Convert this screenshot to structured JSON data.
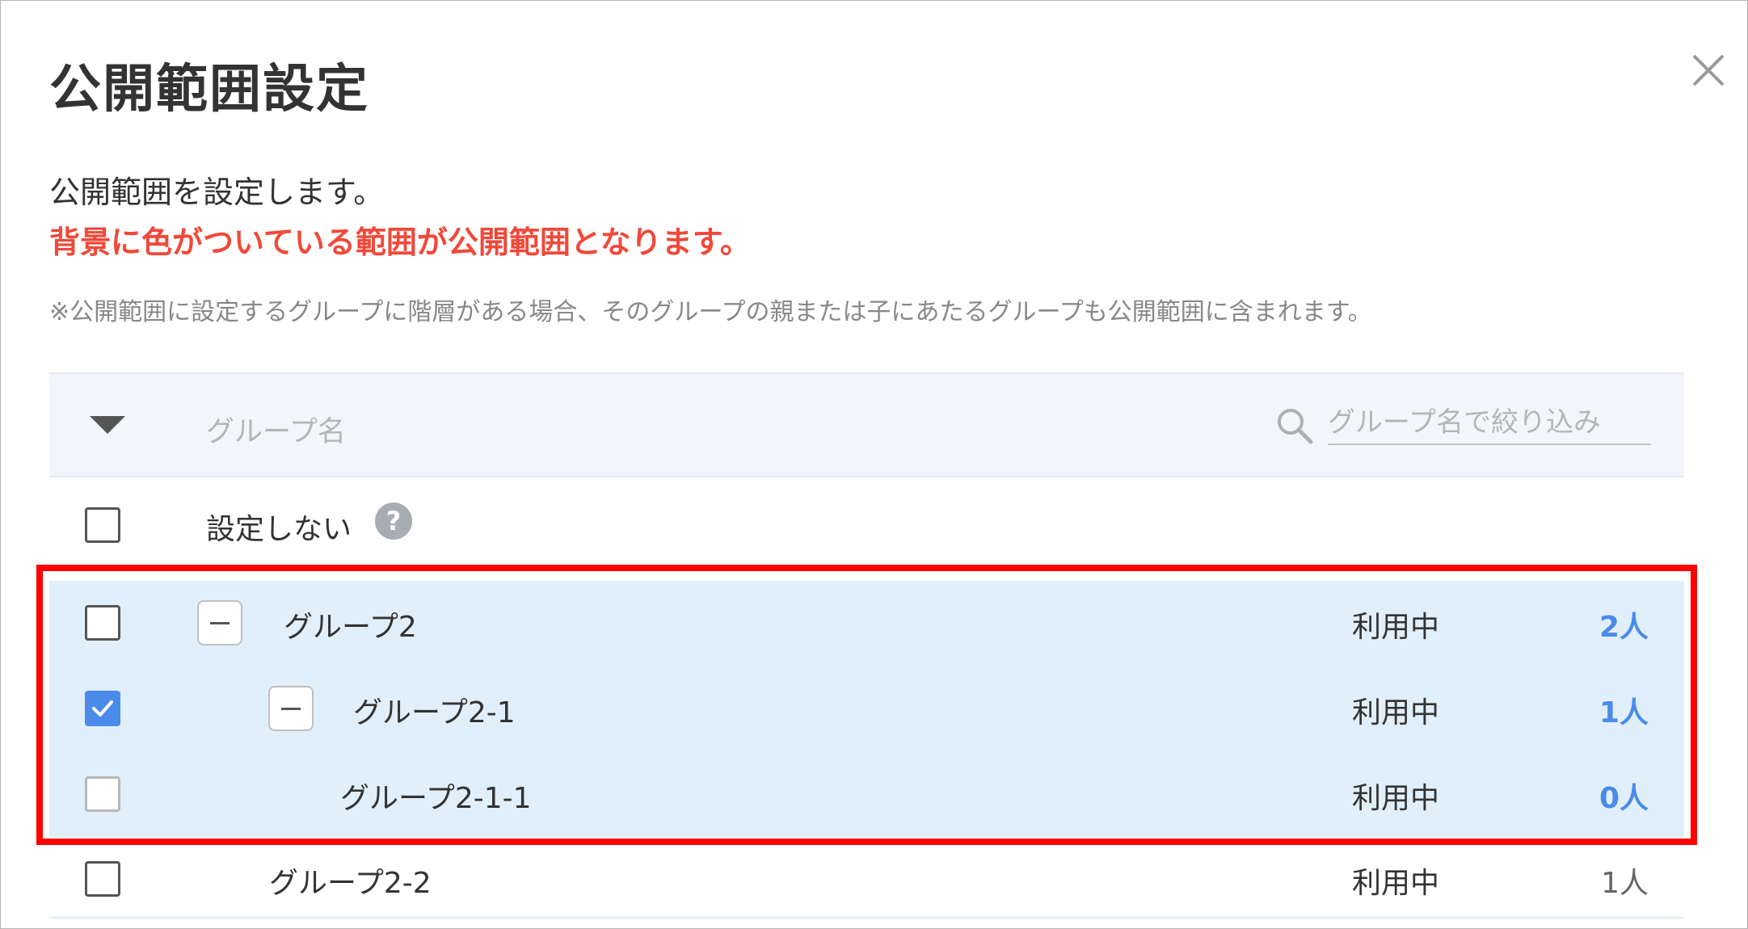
{
  "dialog": {
    "title": "公開範囲設定",
    "description": "公開範囲を設定します。",
    "warning": "背景に色がついている範囲が公開範囲となります。",
    "note": "※公開範囲に設定するグループに階層がある場合、そのグループの親または子にあたるグループも公開範囲に含まれます。"
  },
  "table": {
    "column_name": "グループ名",
    "filter_placeholder": "グループ名で絞り込み",
    "none_option_label": "設定しない",
    "help_glyph": "?",
    "rows": [
      {
        "name": "グループ2",
        "status": "利用中",
        "count": "2人",
        "checked": false,
        "highlighted": true
      },
      {
        "name": "グループ2-1",
        "status": "利用中",
        "count": "1人",
        "checked": true,
        "highlighted": true
      },
      {
        "name": "グループ2-1-1",
        "status": "利用中",
        "count": "0人",
        "checked": false,
        "highlighted": true
      },
      {
        "name": "グループ2-2",
        "status": "利用中",
        "count": "1人",
        "checked": false,
        "highlighted": false
      }
    ]
  },
  "colors": {
    "highlight_bg": "#e1effb",
    "warning_text": "#f0493a",
    "accent_blue": "#4a8bea",
    "annotation_border": "#ff0000"
  },
  "icons": [
    "close-icon",
    "sort-triangle-icon",
    "search-icon",
    "help-icon",
    "checkmark-icon",
    "collapse-minus-icon"
  ]
}
